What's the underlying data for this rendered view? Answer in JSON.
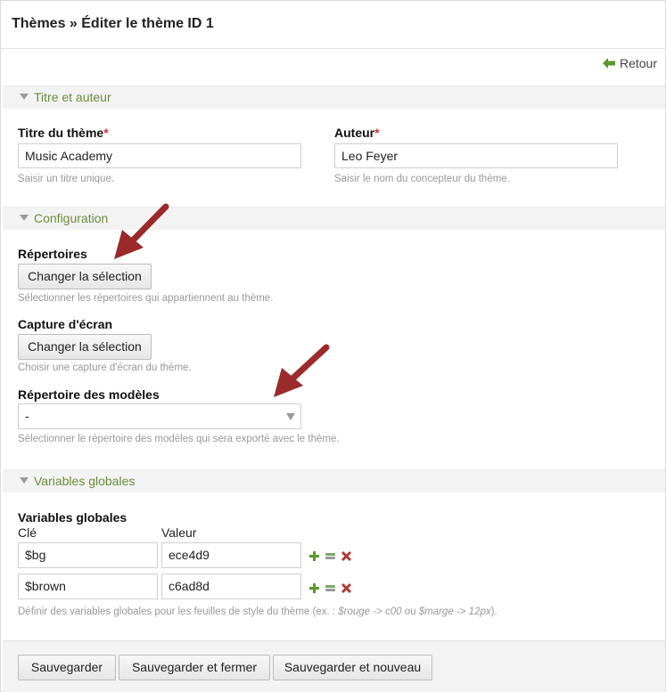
{
  "header": {
    "title": "Thèmes » Éditer le thème ID 1"
  },
  "back": {
    "label": "Retour"
  },
  "sections": {
    "title_author": {
      "legend": "Titre et auteur"
    },
    "configuration": {
      "legend": "Configuration"
    },
    "global_vars": {
      "legend": "Variables globales"
    }
  },
  "fields": {
    "theme_title": {
      "label": "Titre du thème",
      "required_mark": "*",
      "value": "Music Academy",
      "help": "Saisir un titre unique."
    },
    "author": {
      "label": "Auteur",
      "required_mark": "*",
      "value": "Leo Feyer",
      "help": "Saisir le nom du concepteur du thème."
    },
    "directories": {
      "label": "Répertoires",
      "button": "Changer la sélection",
      "help": "Sélectionner les répertoires qui appartiennent au thème."
    },
    "screenshot": {
      "label": "Capture d'écran",
      "button": "Changer la sélection",
      "help": "Choisir une capture d'écran du thème."
    },
    "templates_dir": {
      "label": "Répertoire des modèles",
      "selected": "-",
      "help": "Sélectionner le répertoire des modèles qui sera exporté avec le thème."
    },
    "variables": {
      "label": "Variables globales",
      "col_key": "Clé",
      "col_value": "Valeur",
      "rows": [
        {
          "key": "$bg",
          "value": "ece4d9"
        },
        {
          "key": "$brown",
          "value": "c6ad8d"
        }
      ],
      "help_prefix": "Définir des variables globales pour les feuilles de style du thème (ex. : ",
      "help_ex1": "$rouge",
      "help_arrow1": " -> ",
      "help_ex2": "c00",
      "help_mid": " ou ",
      "help_ex3": "$marge",
      "help_arrow2": " -> ",
      "help_ex4": "12px",
      "help_suffix": ")."
    }
  },
  "actions": {
    "save": "Sauvegarder",
    "save_close": "Sauvegarder et fermer",
    "save_new": "Sauvegarder et nouveau"
  },
  "colors": {
    "legend_text": "#6a8e3a",
    "icon_add": "#5a9a2a",
    "icon_delete": "#b03a3a",
    "arrow": "#9b2a2a"
  }
}
